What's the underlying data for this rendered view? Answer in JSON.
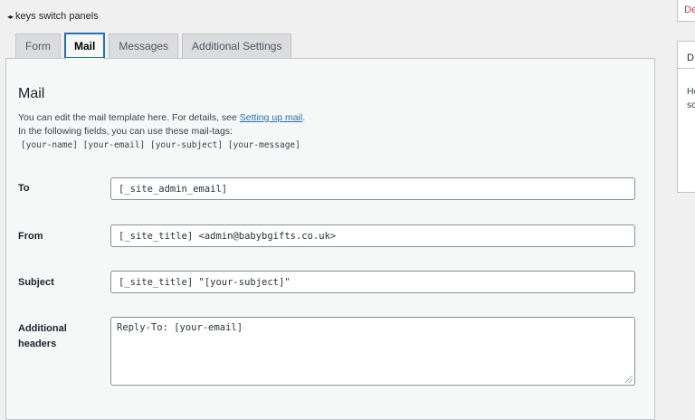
{
  "hint": {
    "icon": "left-right-arrows-icon",
    "arrows": "◂▸",
    "text": "keys switch panels"
  },
  "tabs": [
    {
      "label": "Form",
      "active": false
    },
    {
      "label": "Mail",
      "active": true
    },
    {
      "label": "Messages",
      "active": false
    },
    {
      "label": "Additional Settings",
      "active": false
    }
  ],
  "mail": {
    "title": "Mail",
    "desc_prefix": "You can edit the mail template here. For details, see ",
    "desc_link": "Setting up mail",
    "desc_suffix": ".",
    "desc_line2": "In the following fields, you can use these mail-tags:",
    "mail_tags": "[your-name] [your-email] [your-subject] [your-message]",
    "fields": {
      "to": {
        "label": "To",
        "value": "[_site_admin_email]"
      },
      "from": {
        "label": "From",
        "value": "[_site_title] <admin@babybgifts.co.uk>"
      },
      "subject": {
        "label": "Subject",
        "value": "[_site_title] \"[your-subject]\""
      },
      "headers": {
        "label_line1": "Additional",
        "label_line2": "headers",
        "value": "Reply-To: [your-email]"
      }
    }
  },
  "sidebar": {
    "box1_text": "De",
    "box2_head": "D",
    "box2_line1": "Ho",
    "box2_line2": "sc"
  },
  "colors": {
    "accent": "#2271b1",
    "danger": "#d63638",
    "background": "#f0f0f1"
  }
}
